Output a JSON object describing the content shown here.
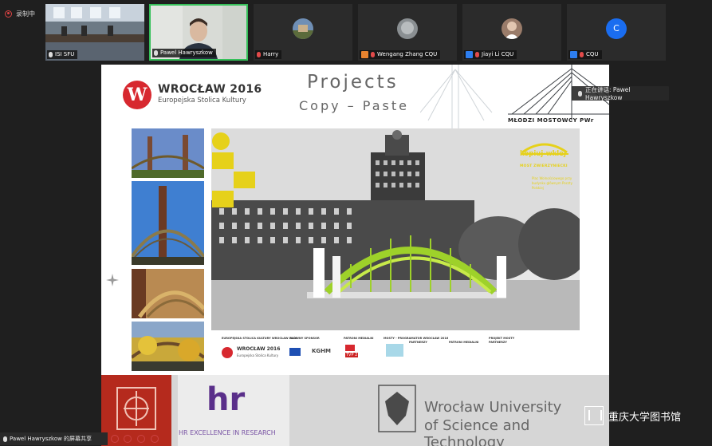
{
  "window": {
    "recording_label": "录制中"
  },
  "participants": [
    {
      "name": "ISI SFU",
      "muted": false,
      "host_tag": false
    },
    {
      "name": "Pawel Hawryszkow",
      "muted": false,
      "host_tag": false,
      "active": true
    },
    {
      "name": "Harry",
      "muted": true,
      "host_tag": false
    },
    {
      "name": "Wengang Zhang CQU",
      "muted": true,
      "host_tag": true
    },
    {
      "name": "Jiayi Li CQU",
      "muted": true,
      "host_tag": true
    },
    {
      "name": "CQU",
      "muted": true,
      "host_tag": true,
      "avatar_letter": "C"
    }
  ],
  "speaking": {
    "label": "正在讲话: Pawel Hawryszkow"
  },
  "slide": {
    "brand_title": "WROCŁAW 2016",
    "brand_subtitle": "Europejska Stolica Kultury",
    "projects_title": "Projects",
    "projects_subtitle": "Copy – Paste",
    "mm_label": "MŁODZI MOSTOWCY PWr",
    "kopiuj_title": "kopiuj-wklej",
    "kopiuj_subtitle": "MOST ZWIERZYNIECKI",
    "kopiuj_note": "Plac Wolnościowego przy budynku głównym Poczty Polskiej",
    "footer_brand_title": "WROCŁAW 2016",
    "footer_brand_sub": "Europejska Stolica Kultury",
    "footer_small": [
      "EUROPEJSKA STOLICA KULTURY WROCŁAW 2016",
      "GŁÓWNY SPONSOR",
      "PATRONI MEDIALNI",
      "MOSTY - PROGRAMATOR WROCŁAW 2016",
      "PARTNERZY",
      "PATRONI MEDIALNI",
      "PROJEKT MOSTY",
      "PARTNERZY"
    ],
    "footer_kghm": "KGHM",
    "footer_tvp": "TVP 2",
    "hr_caption": "HR EXCELLENCE IN RESEARCH",
    "hr_logo": "hr",
    "university_line1": "Wrocław University",
    "university_line2": "of Science and Technology"
  },
  "bottom": {
    "share_label": "Pawel Hawryszkow 的屏幕共享",
    "watermark": "重庆大学图书馆"
  },
  "colors": {
    "accent_red": "#d7282f",
    "yellow": "#e6d11a",
    "active_green": "#36c05a",
    "avatar_blue": "#1a6df0"
  }
}
